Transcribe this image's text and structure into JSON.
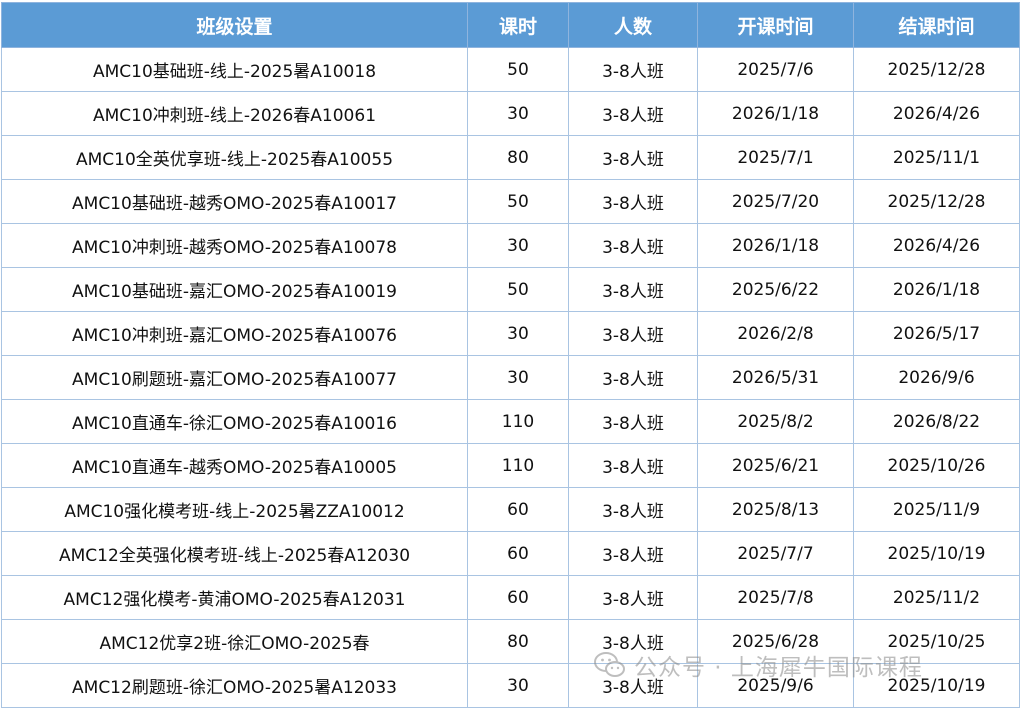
{
  "table": {
    "headers": [
      "班级设置",
      "课时",
      "人数",
      "开课时间",
      "结课时间"
    ],
    "rows": [
      [
        "AMC10基础班-线上-2025暑A10018",
        "50",
        "3-8人班",
        "2025/7/6",
        "2025/12/28"
      ],
      [
        "AMC10冲刺班-线上-2026春A10061",
        "30",
        "3-8人班",
        "2026/1/18",
        "2026/4/26"
      ],
      [
        "AMC10全英优享班-线上-2025春A10055",
        "80",
        "3-8人班",
        "2025/7/1",
        "2025/11/1"
      ],
      [
        "AMC10基础班-越秀OMO-2025春A10017",
        "50",
        "3-8人班",
        "2025/7/20",
        "2025/12/28"
      ],
      [
        "AMC10冲刺班-越秀OMO-2025春A10078",
        "30",
        "3-8人班",
        "2026/1/18",
        "2026/4/26"
      ],
      [
        "AMC10基础班-嘉汇OMO-2025春A10019",
        "50",
        "3-8人班",
        "2025/6/22",
        "2026/1/18"
      ],
      [
        "AMC10冲刺班-嘉汇OMO-2025春A10076",
        "30",
        "3-8人班",
        "2026/2/8",
        "2026/5/17"
      ],
      [
        "AMC10刷题班-嘉汇OMO-2025春A10077",
        "30",
        "3-8人班",
        "2026/5/31",
        "2026/9/6"
      ],
      [
        "AMC10直通车-徐汇OMO-2025春A10016",
        "110",
        "3-8人班",
        "2025/8/2",
        "2026/8/22"
      ],
      [
        "AMC10直通车-越秀OMO-2025春A10005",
        "110",
        "3-8人班",
        "2025/6/21",
        "2025/10/26"
      ],
      [
        "AMC10强化模考班-线上-2025暑ZZA10012",
        "60",
        "3-8人班",
        "2025/8/13",
        "2025/11/9"
      ],
      [
        "AMC12全英强化模考班-线上-2025春A12030",
        "60",
        "3-8人班",
        "2025/7/7",
        "2025/10/19"
      ],
      [
        "AMC12强化模考-黄浦OMO-2025春A12031",
        "60",
        "3-8人班",
        "2025/7/8",
        "2025/11/2"
      ],
      [
        "AMC12优享2班-徐汇OMO-2025春",
        "80",
        "3-8人班",
        "2025/6/28",
        "2025/10/25"
      ],
      [
        "AMC12刷题班-徐汇OMO-2025暑A12033",
        "30",
        "3-8人班",
        "2025/9/6",
        "2025/10/19"
      ]
    ]
  },
  "watermark": {
    "icon": "wechat-icon",
    "text": "公众号 · 上海犀牛国际课程"
  }
}
